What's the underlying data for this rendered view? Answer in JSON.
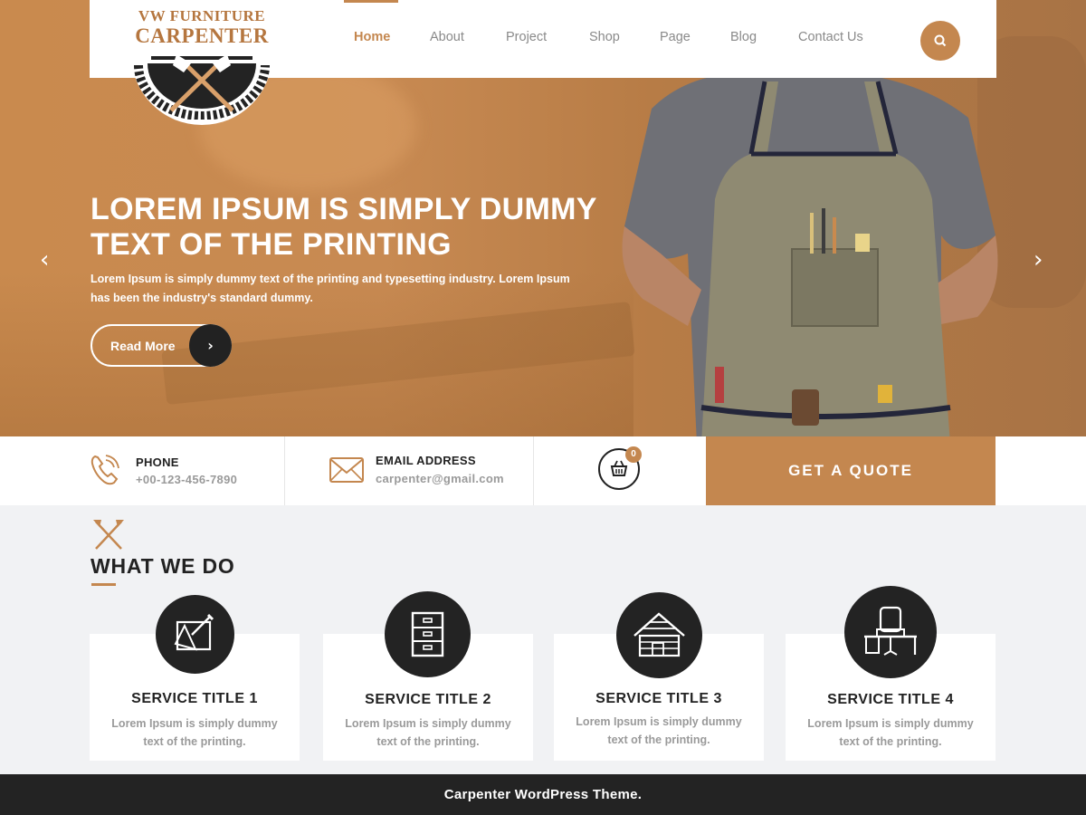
{
  "brand": {
    "line1": "VW FURNITURE",
    "line2": "CARPENTER",
    "accent_color": "#c4874f",
    "dark_color": "#232323"
  },
  "nav": {
    "items": [
      {
        "label": "Home",
        "active": true
      },
      {
        "label": "About"
      },
      {
        "label": "Project"
      },
      {
        "label": "Shop"
      },
      {
        "label": "Page"
      },
      {
        "label": "Blog"
      },
      {
        "label": "Contact Us"
      }
    ],
    "search_icon": "search-icon"
  },
  "hero": {
    "title_line1": "LOREM IPSUM IS SIMPLY DUMMY",
    "title_line2": "TEXT OF THE PRINTING",
    "subtitle_line1": "Lorem Ipsum is simply dummy text of the printing and typesetting industry. Lorem Ipsum",
    "subtitle_line2": "has been the industry's standard dummy.",
    "read_more": "Read More",
    "prev_icon": "‹",
    "next_icon": "›",
    "read_more_arrow": "›"
  },
  "info": {
    "phone_label": "PHONE",
    "phone_value": "+00-123-456-7890",
    "email_label": "EMAIL ADDRESS",
    "email_value": "carpenter@gmail.com",
    "cart_count": "0",
    "quote_button": "GET A QUOTE"
  },
  "services": {
    "heading": "WHAT WE DO",
    "items": [
      {
        "title": "SERVICE TITLE 1",
        "text": "Lorem Ipsum is simply dummy text of the printing.",
        "icon": "drafting-icon"
      },
      {
        "title": "SERVICE TITLE 2",
        "text": "Lorem Ipsum is simply dummy text of the printing.",
        "icon": "cabinet-icon"
      },
      {
        "title": "SERVICE TITLE 3",
        "text": "Lorem Ipsum is simply dummy text of the printing.",
        "icon": "cabin-icon"
      },
      {
        "title": "SERVICE TITLE 4",
        "text": "Lorem Ipsum is simply dummy text of the printing.",
        "icon": "desk-chair-icon"
      }
    ]
  },
  "footer": {
    "text": "Carpenter WordPress Theme."
  }
}
